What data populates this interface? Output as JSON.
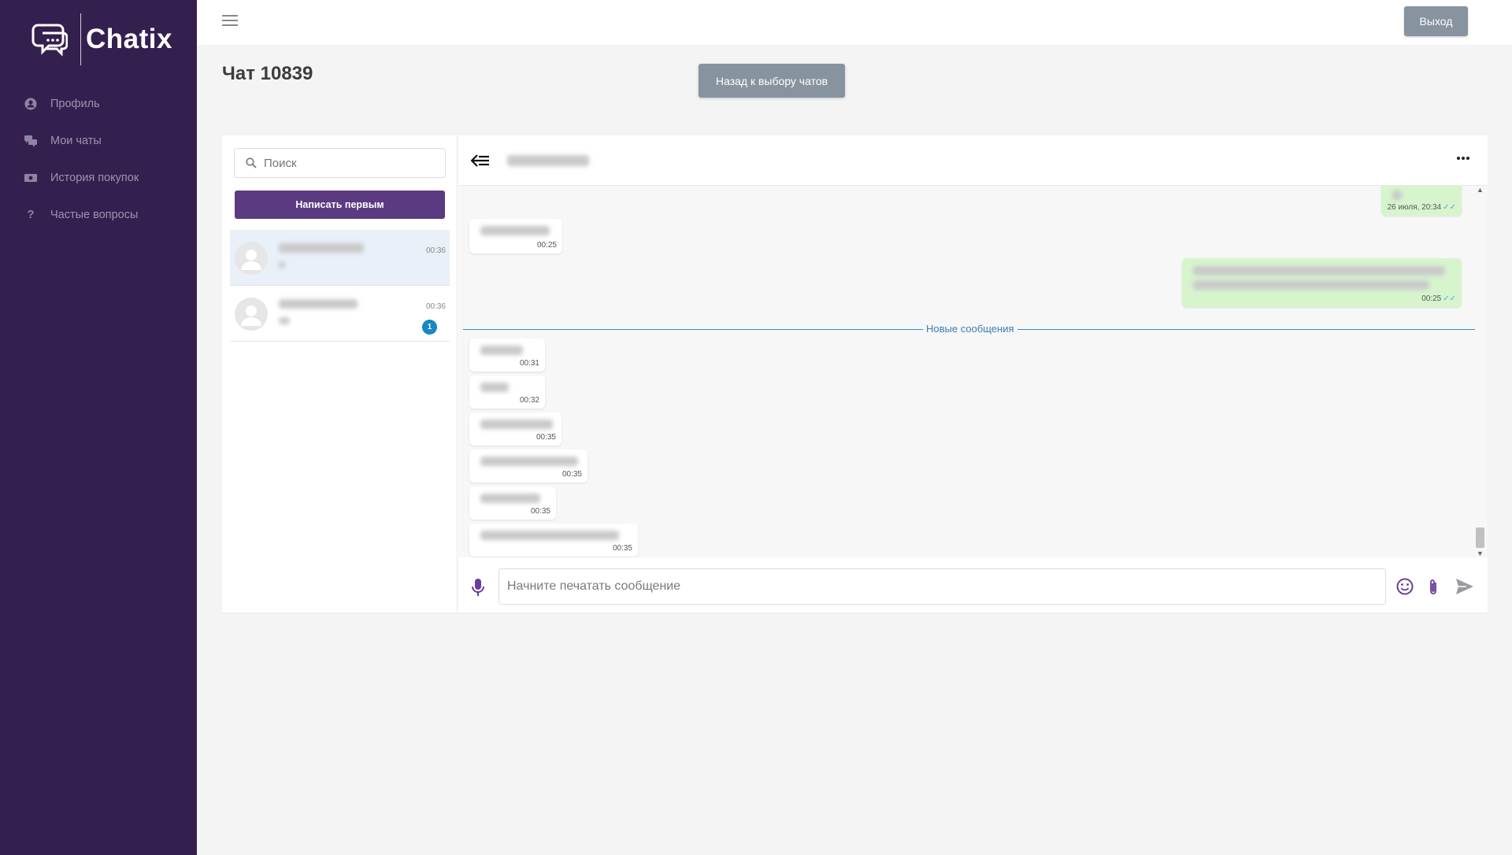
{
  "app": {
    "name": "Chatix"
  },
  "sidebar": {
    "items": [
      {
        "label": "Профиль",
        "icon": "user-circle-icon"
      },
      {
        "label": "Мои чаты",
        "icon": "chats-icon"
      },
      {
        "label": "История покупок",
        "icon": "money-icon"
      },
      {
        "label": "Частые вопросы",
        "icon": "question-icon"
      }
    ]
  },
  "topbar": {
    "logout_label": "Выход"
  },
  "page": {
    "title": "Чат 10839",
    "back_label": "Назад к выбору чатов"
  },
  "chat_list": {
    "search_placeholder": "Поиск",
    "write_first_label": "Написать первым",
    "contacts": [
      {
        "time": "00:36",
        "unread": ""
      },
      {
        "time": "00:36",
        "unread": "1"
      }
    ]
  },
  "conversation": {
    "new_messages_label": "Новые сообщения",
    "input_placeholder": "Начните печатать сообщение",
    "messages": [
      {
        "direction": "out",
        "time": "26 июля, 20:34"
      },
      {
        "direction": "in",
        "time": "00:25"
      },
      {
        "direction": "out",
        "time": "00:25"
      },
      {
        "direction": "in",
        "time": "00:31"
      },
      {
        "direction": "in",
        "time": "00:32"
      },
      {
        "direction": "in",
        "time": "00:35"
      },
      {
        "direction": "in",
        "time": "00:35"
      },
      {
        "direction": "in",
        "time": "00:35"
      },
      {
        "direction": "in",
        "time": "00:35"
      }
    ]
  },
  "colors": {
    "sidebar_bg": "#34204f",
    "accent_purple": "#5b3a82",
    "button_gray": "#8893a0",
    "outgoing_bubble": "#d7f5cd",
    "badge_blue": "#1787c5",
    "divider_blue": "#3b8dbd"
  }
}
